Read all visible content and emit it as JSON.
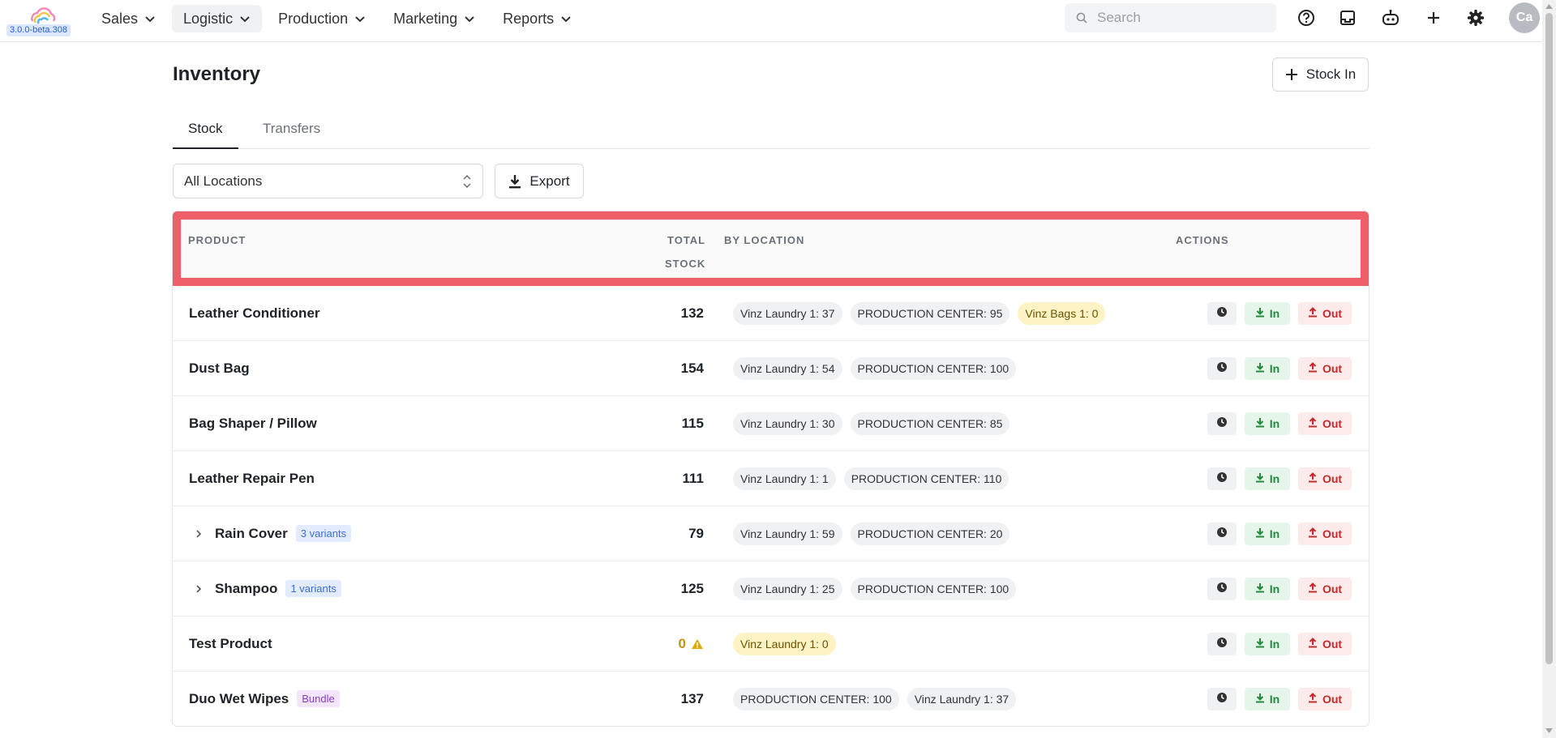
{
  "app": {
    "version": "3.0.0-beta.308"
  },
  "nav": {
    "items": [
      {
        "label": "Sales",
        "active": false
      },
      {
        "label": "Logistic",
        "active": true
      },
      {
        "label": "Production",
        "active": false
      },
      {
        "label": "Marketing",
        "active": false
      },
      {
        "label": "Reports",
        "active": false
      }
    ]
  },
  "search": {
    "placeholder": "Search",
    "value": ""
  },
  "topbar_icons": [
    "help-icon",
    "inbox-icon",
    "robot-icon",
    "plus-icon",
    "gear-icon"
  ],
  "user": {
    "initials": "Ca"
  },
  "page": {
    "title": "Inventory",
    "stock_in_label": "Stock In",
    "tabs": [
      {
        "label": "Stock",
        "active": true
      },
      {
        "label": "Transfers",
        "active": false
      }
    ],
    "location_select": {
      "value": "All Locations"
    },
    "export_label": "Export"
  },
  "table": {
    "headers": {
      "product": "PRODUCT",
      "total_line1": "TOTAL",
      "total_line2": "STOCK",
      "by_location": "BY LOCATION",
      "actions": "ACTIONS"
    },
    "action_labels": {
      "in": "In",
      "out": "Out"
    },
    "rows": [
      {
        "name": "Leather Conditioner",
        "total": "132",
        "locations": [
          {
            "text": "Vinz Laundry 1: 37",
            "warn": false
          },
          {
            "text": "PRODUCTION CENTER: 95",
            "warn": false
          },
          {
            "text": "Vinz Bags 1: 0",
            "warn": true
          }
        ]
      },
      {
        "name": "Dust Bag",
        "total": "154",
        "locations": [
          {
            "text": "Vinz Laundry 1: 54",
            "warn": false
          },
          {
            "text": "PRODUCTION CENTER: 100",
            "warn": false
          }
        ]
      },
      {
        "name": "Bag Shaper / Pillow",
        "total": "115",
        "locations": [
          {
            "text": "Vinz Laundry 1: 30",
            "warn": false
          },
          {
            "text": "PRODUCTION CENTER: 85",
            "warn": false
          }
        ]
      },
      {
        "name": "Leather Repair Pen",
        "total": "111",
        "locations": [
          {
            "text": "Vinz Laundry 1: 1",
            "warn": false
          },
          {
            "text": "PRODUCTION CENTER: 110",
            "warn": false
          }
        ]
      },
      {
        "name": "Rain Cover",
        "total": "79",
        "expandable": true,
        "badge": "3 variants",
        "badge_type": "variants",
        "locations": [
          {
            "text": "Vinz Laundry 1: 59",
            "warn": false
          },
          {
            "text": "PRODUCTION CENTER: 20",
            "warn": false
          }
        ]
      },
      {
        "name": "Shampoo",
        "total": "125",
        "expandable": true,
        "badge": "1 variants",
        "badge_type": "variants",
        "locations": [
          {
            "text": "Vinz Laundry 1: 25",
            "warn": false
          },
          {
            "text": "PRODUCTION CENTER: 100",
            "warn": false
          }
        ]
      },
      {
        "name": "Test Product",
        "total": "0",
        "total_warn": true,
        "locations": [
          {
            "text": "Vinz Laundry 1: 0",
            "warn": true
          }
        ]
      },
      {
        "name": "Duo Wet Wipes",
        "total": "137",
        "badge": "Bundle",
        "badge_type": "bundle",
        "locations": [
          {
            "text": "PRODUCTION CENTER: 100",
            "warn": false
          },
          {
            "text": "Vinz Laundry 1: 37",
            "warn": false
          }
        ]
      }
    ]
  },
  "colors": {
    "highlight": "#ef5f6a",
    "in": "#1f8a3b",
    "out": "#c42b2b",
    "warn": "#c8930a"
  }
}
